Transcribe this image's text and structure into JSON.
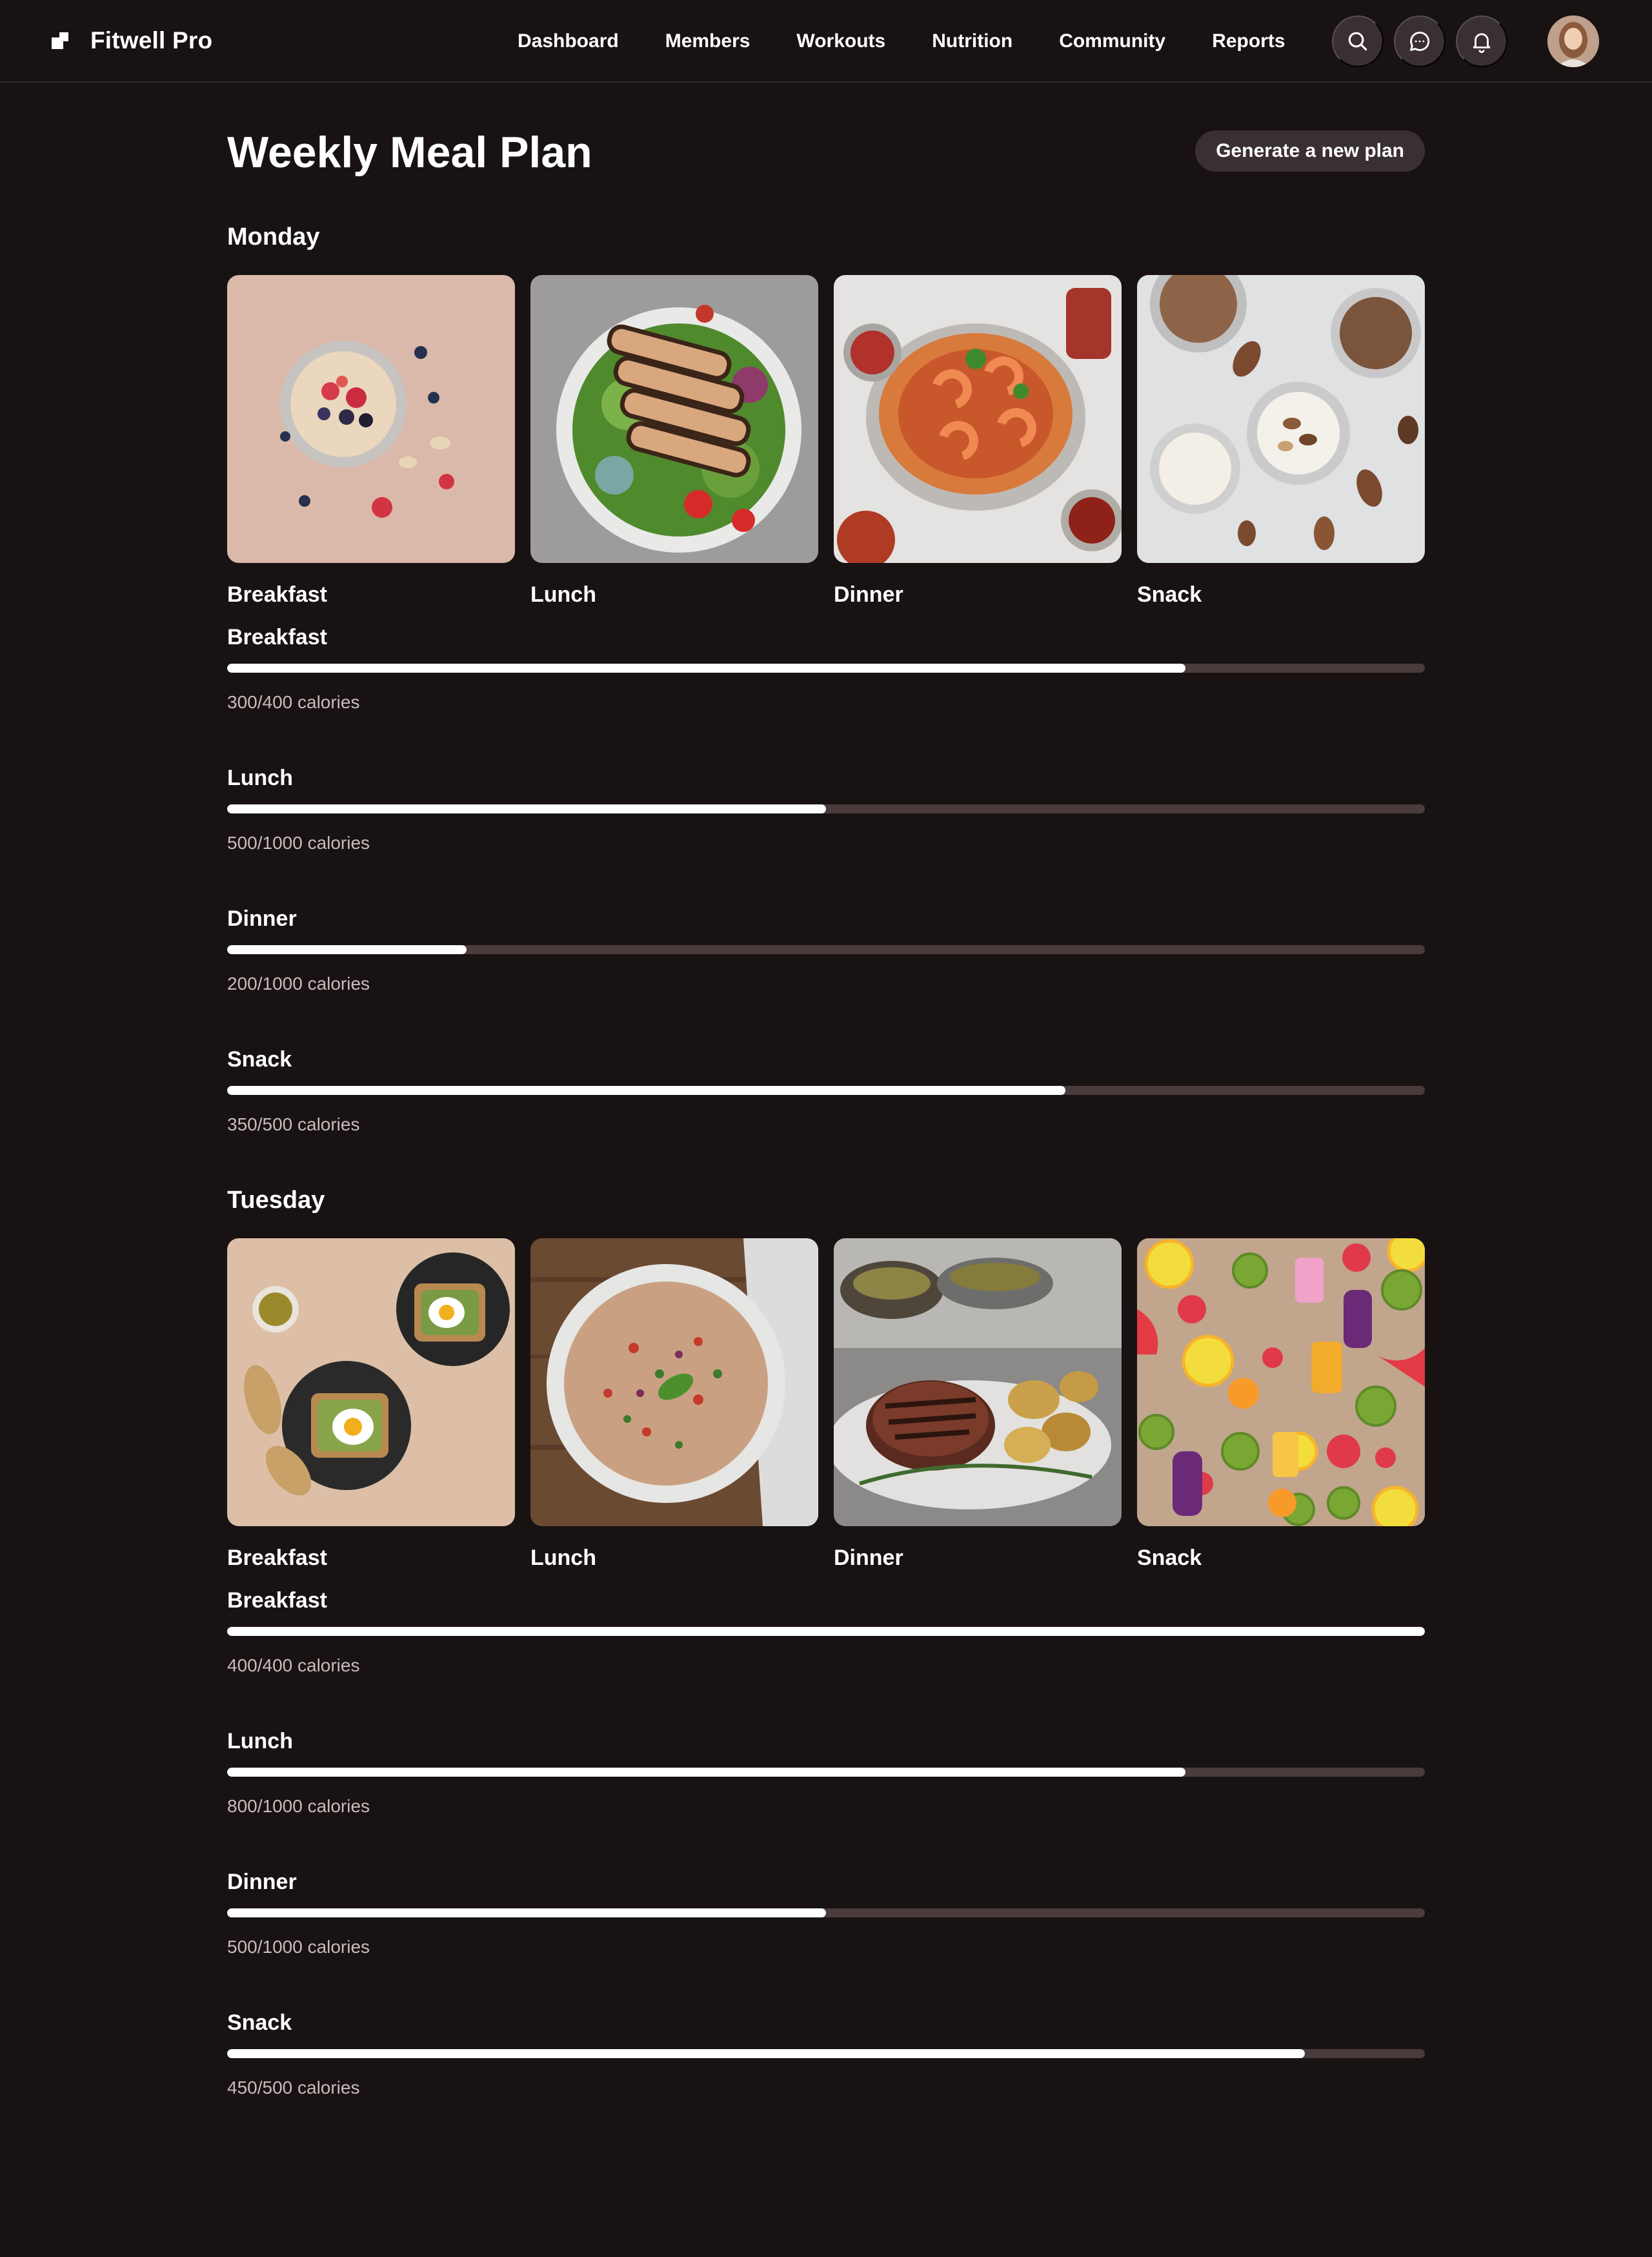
{
  "app": {
    "name": "Fitwell Pro"
  },
  "nav": {
    "items": [
      {
        "label": "Dashboard"
      },
      {
        "label": "Members"
      },
      {
        "label": "Workouts"
      },
      {
        "label": "Nutrition"
      },
      {
        "label": "Community"
      },
      {
        "label": "Reports"
      }
    ]
  },
  "header_icons": [
    "search-icon",
    "chat-icon",
    "bell-icon"
  ],
  "page": {
    "title": "Weekly Meal Plan",
    "generate_label": "Generate a new plan"
  },
  "colors": {
    "background": "#181213",
    "surface": "#3a2f31",
    "track": "#4a3c3d",
    "fill": "#ffffff"
  },
  "days": [
    {
      "name": "Monday",
      "meals": [
        {
          "label": "Breakfast",
          "image": "oatmeal-with-berries"
        },
        {
          "label": "Lunch",
          "image": "grilled-chicken-salad"
        },
        {
          "label": "Dinner",
          "image": "shrimp-pasta"
        },
        {
          "label": "Snack",
          "image": "yogurt-and-nuts"
        }
      ],
      "progress": [
        {
          "label": "Breakfast",
          "text": "300/400 calories",
          "fraction": 0.8
        },
        {
          "label": "Lunch",
          "text": "500/1000 calories",
          "fraction": 0.5
        },
        {
          "label": "Dinner",
          "text": "200/1000 calories",
          "fraction": 0.2
        },
        {
          "label": "Snack",
          "text": "350/500 calories",
          "fraction": 0.7
        }
      ]
    },
    {
      "name": "Tuesday",
      "meals": [
        {
          "label": "Breakfast",
          "image": "avocado-toast-with-eggs"
        },
        {
          "label": "Lunch",
          "image": "quinoa-salad"
        },
        {
          "label": "Dinner",
          "image": "steak-with-potatoes"
        },
        {
          "label": "Snack",
          "image": "fruits-and-smoothies"
        }
      ],
      "progress": [
        {
          "label": "Breakfast",
          "text": "400/400 calories",
          "fraction": 1.0
        },
        {
          "label": "Lunch",
          "text": "800/1000 calories",
          "fraction": 0.8
        },
        {
          "label": "Dinner",
          "text": "500/1000 calories",
          "fraction": 0.5
        },
        {
          "label": "Snack",
          "text": "450/500 calories",
          "fraction": 0.9
        }
      ]
    }
  ]
}
